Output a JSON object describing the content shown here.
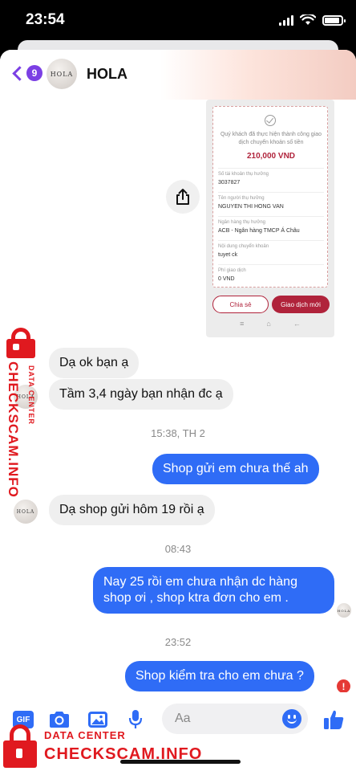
{
  "status_bar": {
    "time": "23:54"
  },
  "header": {
    "back_count": "9",
    "avatar_text": "HOLA",
    "contact_name": "HOLA"
  },
  "receipt": {
    "message": "Quý khách đã thực hiện thành công giao dịch chuyển khoản số tiền",
    "amount": "210,000 VND",
    "fields": [
      {
        "label": "Số tài khoản thụ hưởng",
        "value": "3037827"
      },
      {
        "label": "Tên người thụ hưởng",
        "value": "NGUYEN THI HONG VAN"
      },
      {
        "label": "Ngân hàng thụ hưởng",
        "value": "ACB - Ngân hàng TMCP Á Châu"
      },
      {
        "label": "Nội dung chuyển khoản",
        "value": "tuyet ck"
      },
      {
        "label": "Phí giao dịch",
        "value": "0 VND"
      }
    ],
    "share_label": "Chia sẻ",
    "new_transaction_label": "Giao dịch mới",
    "nav_icons": [
      "menu-icon",
      "home-icon",
      "back-icon"
    ]
  },
  "messages": [
    {
      "dir": "in",
      "text": "Dạ ok bạn ạ"
    },
    {
      "dir": "in",
      "text": "Tầm 3,4 ngày bạn nhận đc ạ"
    },
    {
      "dir": "ts",
      "text": "15:38, TH 2"
    },
    {
      "dir": "out",
      "text": "Shop gửi em chưa thế ah"
    },
    {
      "dir": "in",
      "text": "Dạ shop gửi hôm 19 rồi ạ"
    },
    {
      "dir": "ts",
      "text": "08:43"
    },
    {
      "dir": "out",
      "text": "Nay 25 rồi em chưa nhận dc hàng shop ơi , shop ktra đơn cho em ."
    },
    {
      "dir": "ts",
      "text": "23:52"
    },
    {
      "dir": "out",
      "text": "Shop kiểm tra cho em chưa ?"
    }
  ],
  "composer": {
    "gif_label": "GIF",
    "placeholder": "Aa",
    "icons": [
      "gif-icon",
      "camera-icon",
      "image-icon",
      "microphone-icon",
      "emoji-icon",
      "thumbs-up-icon"
    ]
  },
  "watermark": {
    "line1": "DATA CENTER",
    "line2": "CHECKSCAM.INFO"
  },
  "colors": {
    "accent": "#2f6cf6",
    "back_purple": "#7b3fe4",
    "error": "#e53935",
    "watermark": "#e0191f",
    "receipt_brand": "#b0233b"
  }
}
